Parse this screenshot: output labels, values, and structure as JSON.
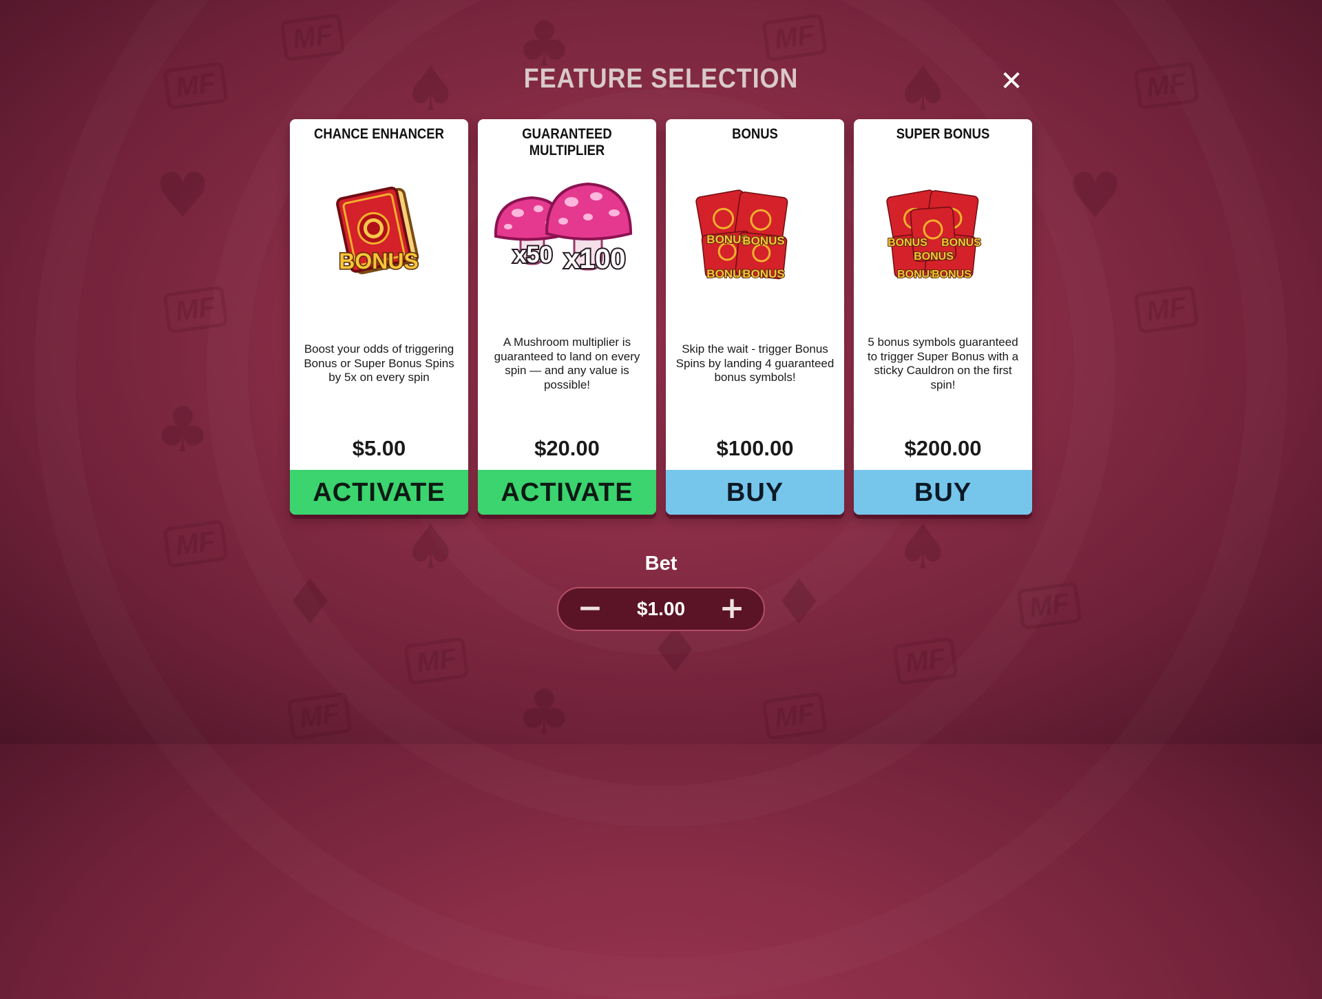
{
  "header": {
    "title": "FEATURE SELECTION",
    "close_glyph": "✕"
  },
  "cards": [
    {
      "title": "CHANCE ENHANCER",
      "art_text": "BONUS",
      "description": "Boost your odds of triggering Bonus or Super Bonus Spins by 5x on every spin",
      "price": "$5.00",
      "button": "ACTIVATE",
      "button_color": "#3bd46e"
    },
    {
      "title": "GUARANTEED MULTIPLIER",
      "art_text": [
        "x50",
        "x100"
      ],
      "description": "A Mushroom multiplier is guaranteed to land on every spin — and any value is possible!",
      "price": "$20.00",
      "button": "ACTIVATE",
      "button_color": "#3bd46e"
    },
    {
      "title": "BONUS",
      "art_text": [
        "BONUS",
        "BONUS",
        "BONUS",
        "BONUS"
      ],
      "description": "Skip the wait - trigger Bonus Spins by landing 4 guaranteed bonus symbols!",
      "price": "$100.00",
      "button": "BUY",
      "button_color": "#76c6ec"
    },
    {
      "title": "SUPER BONUS",
      "art_text": [
        "BONUS",
        "BONUS",
        "BONUS",
        "BONUS",
        "BONUS"
      ],
      "description": "5 bonus symbols guaranteed to trigger Super Bonus with a sticky Cauldron on the first spin!",
      "price": "$200.00",
      "button": "BUY",
      "button_color": "#76c6ec"
    }
  ],
  "bet": {
    "label": "Bet",
    "value": "$1.00",
    "minus_glyph": "−",
    "plus_glyph": "+"
  },
  "background": {
    "watermark_text": "MF",
    "suits": [
      "♠",
      "♣",
      "♥",
      "♦"
    ]
  }
}
